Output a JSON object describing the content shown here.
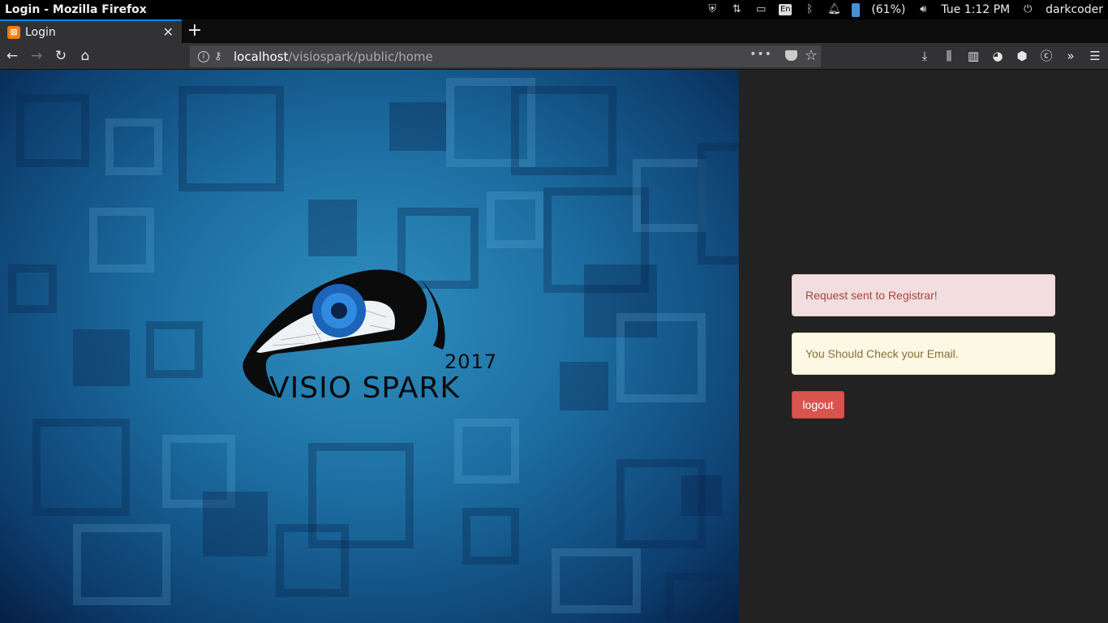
{
  "os": {
    "window_title": "Login - Mozilla Firefox",
    "keyboard_layout": "En",
    "battery": "(61%)",
    "clock": "Tue  1:12 PM",
    "user": "darkcoder"
  },
  "browser": {
    "tab_title": "Login",
    "url_host": "localhost",
    "url_path": "/visiospark/public/home",
    "page_actions": "•••"
  },
  "hero": {
    "logo_year": "2017",
    "logo_text": "VISIO SPARK"
  },
  "panel": {
    "alert_request": "Request sent to Registrar!",
    "alert_email": "You Should Check your Email.",
    "logout_label": "logout"
  },
  "colors": {
    "danger_bg": "#f2dede",
    "warning_bg": "#fcf8e3",
    "logout_bg": "#d9534f",
    "accent": "#0a84ff"
  }
}
